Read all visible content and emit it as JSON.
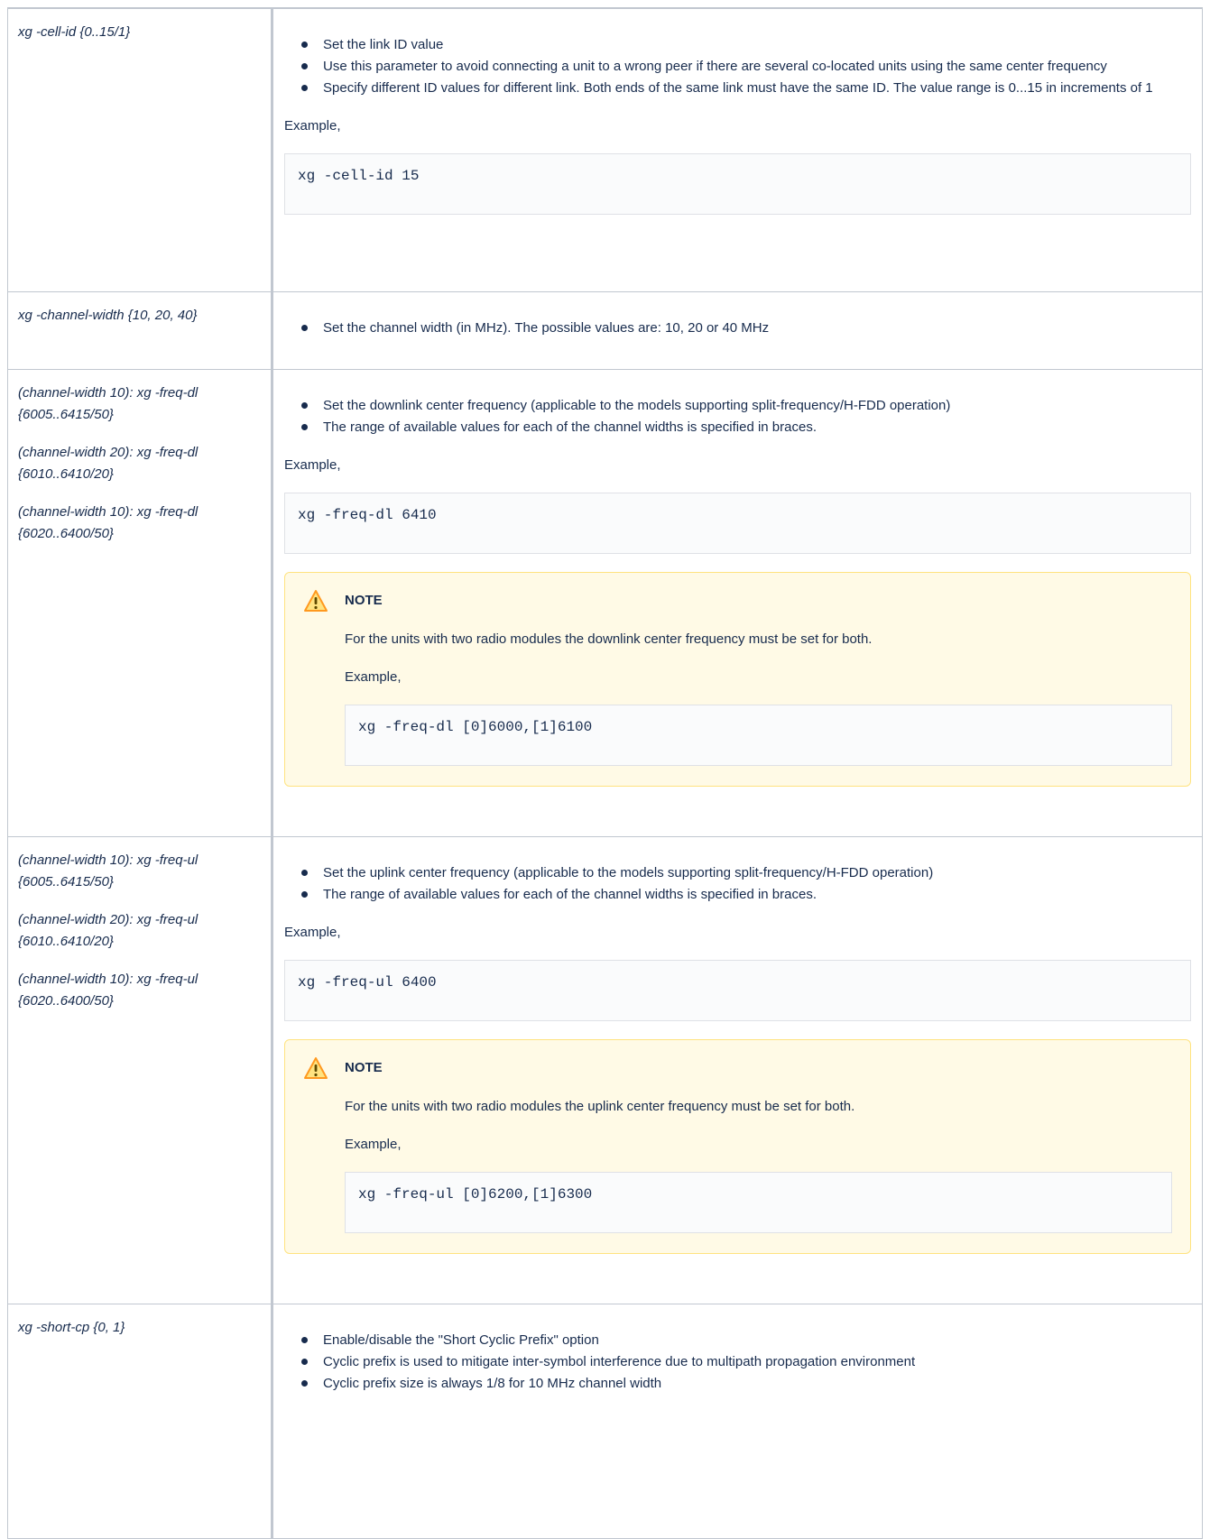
{
  "rows": [
    {
      "params": [
        "xg -cell-id {0..15/1}"
      ],
      "bullets": [
        "Set the link ID value",
        "Use this parameter to avoid connecting a unit to a wrong peer if there are several co-located units using the same center frequency",
        "Specify different ID values for different link. Both ends of the same link must have the same ID. The value range is 0...15 in increments of 1"
      ],
      "example_label": "Example,",
      "code": "xg -cell-id 15"
    },
    {
      "params": [
        "xg -channel-width {10, 20, 40}"
      ],
      "bullets": [
        "Set the channel width (in MHz). The possible values are: 10, 20 or 40 MHz"
      ]
    },
    {
      "params": [
        "(channel-width 10): xg -freq-dl {6005..6415/50}",
        "(channel-width 20): xg -freq-dl {6010..6410/20}",
        "(channel-width 10): xg -freq-dl {6020..6400/50}"
      ],
      "bullets": [
        "Set the downlink center frequency (applicable to the models supporting split-frequency/H-FDD operation)",
        "The range of available values for each of the channel widths is specified in braces."
      ],
      "example_label": "Example,",
      "code": "xg -freq-dl 6410",
      "note": {
        "title": "NOTE",
        "text": "For the units with two radio modules the downlink center frequency must be set for both.",
        "example_label": "Example,",
        "code": "xg -freq-dl [0]6000,[1]6100"
      }
    },
    {
      "params": [
        "(channel-width 10): xg -freq-ul {6005..6415/50}",
        "(channel-width 20): xg -freq-ul {6010..6410/20}",
        "(channel-width 10): xg -freq-ul {6020..6400/50}"
      ],
      "bullets": [
        "Set the uplink center frequency (applicable to the models supporting split-frequency/H-FDD operation)",
        "The range of available values for each of the channel widths is specified in braces."
      ],
      "example_label": "Example,",
      "code": "xg -freq-ul 6400",
      "note": {
        "title": "NOTE",
        "text": "For the units with two radio modules the uplink center frequency must be set for both.",
        "example_label": "Example,",
        "code": "xg -freq-ul [0]6200,[1]6300"
      }
    },
    {
      "params": [
        "xg -short-cp {0, 1}"
      ],
      "bullets": [
        "Enable/disable the \"Short Cyclic Prefix\" option",
        "Cyclic prefix is used to mitigate inter-symbol interference due to multipath propagation environment",
        "Cyclic prefix size is always 1/8 for 10 MHz channel width"
      ]
    }
  ],
  "icons": {
    "note": "warning-icon",
    "note_color": "#ff991f"
  },
  "colors": {
    "border": "#c1c7d0",
    "note_bg": "#fffae6",
    "note_border": "#ffe380",
    "code_bg": "#fafbfc"
  }
}
